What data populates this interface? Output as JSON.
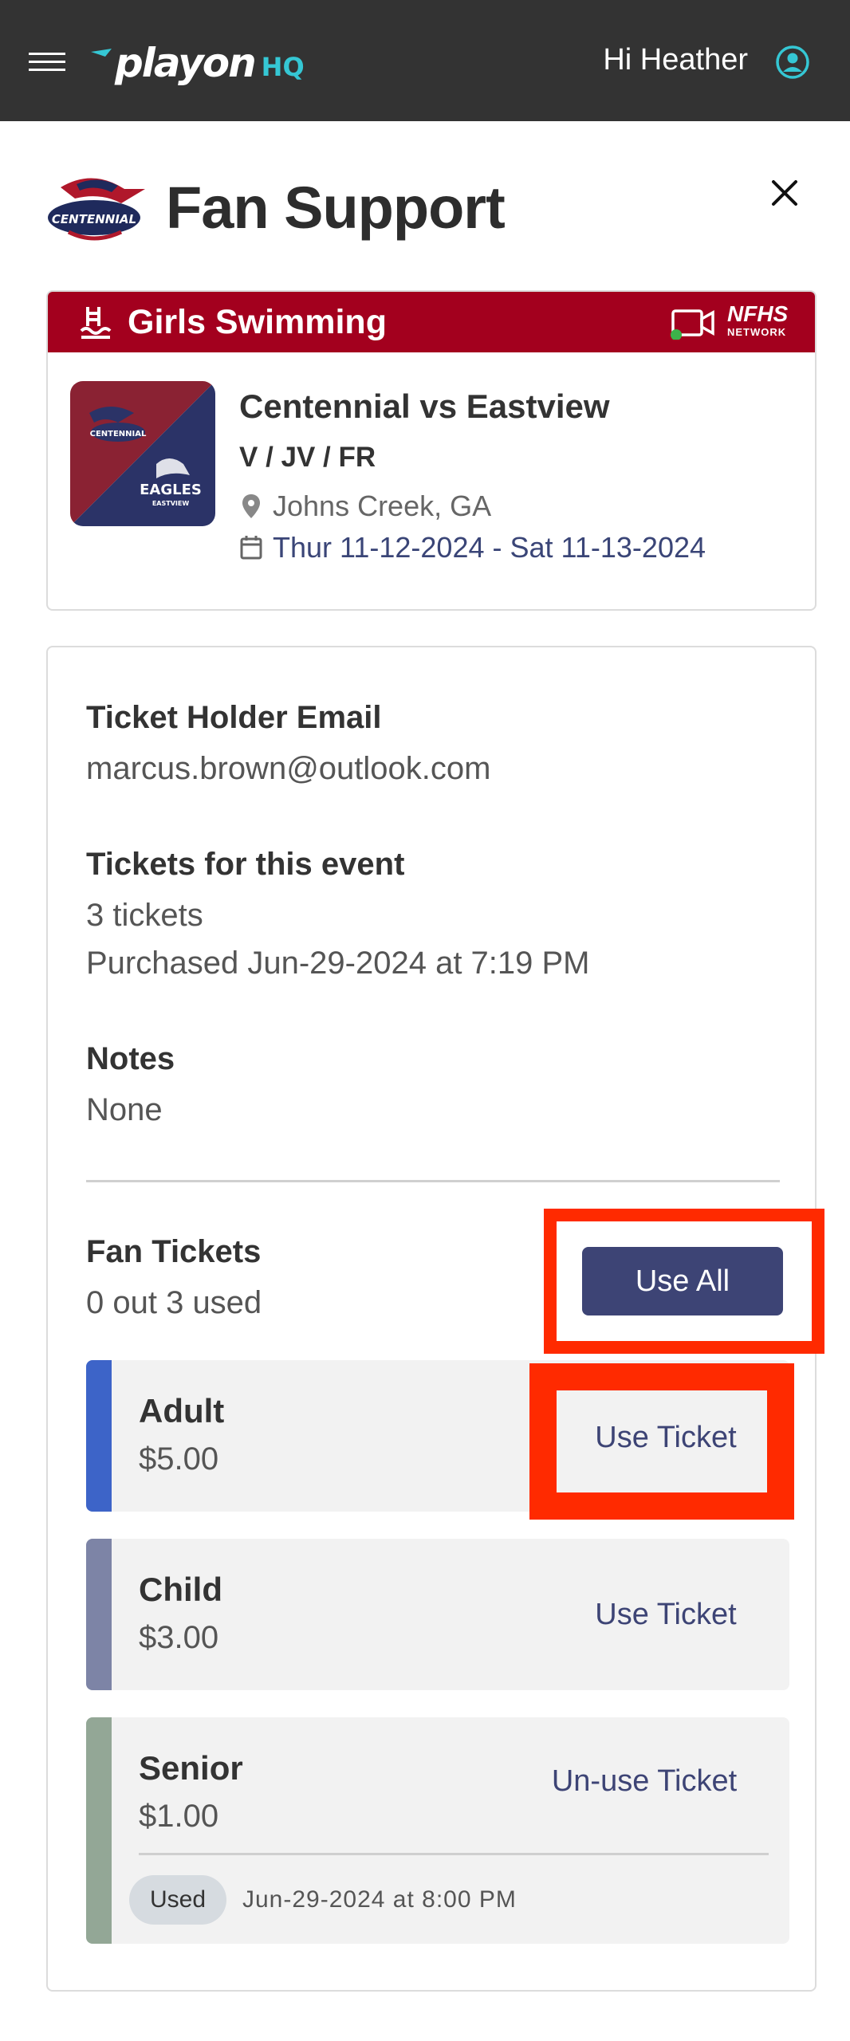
{
  "nav": {
    "brand": "playon",
    "brand_suffix": "HQ",
    "greeting": "Hi Heather"
  },
  "header": {
    "school_logo_text": "CENTENNIAL",
    "title": "Fan Support"
  },
  "event": {
    "sport": "Girls Swimming",
    "network": "NFHS",
    "network_sub": "NETWORK",
    "name": "Centennial vs Eastview",
    "levels": "V / JV / FR",
    "location": "Johns Creek, GA",
    "dates": "Thur 11-12-2024 - Sat 11-13-2024",
    "home_team_label": "CENTENNIAL",
    "away_team_label": "EAGLES",
    "away_team_sub": "EASTVIEW",
    "colors": {
      "sport_bar": "#a3001e",
      "home": "#8a2233",
      "away": "#2b3367"
    }
  },
  "details": {
    "email_label": "Ticket Holder Email",
    "email_value": "marcus.brown@outlook.com",
    "tickets_label": "Tickets for this event",
    "tickets_count": "3 tickets",
    "purchased": "Purchased Jun-29-2024 at 7:19 PM",
    "notes_label": "Notes",
    "notes_value": "None"
  },
  "fan_tickets": {
    "label": "Fan Tickets",
    "used_summary": "0 out 3 used",
    "use_all_label": "Use All",
    "items": [
      {
        "type": "Adult",
        "price": "$5.00",
        "action": "Use Ticket",
        "stripe": "#3d64c8"
      },
      {
        "type": "Child",
        "price": "$3.00",
        "action": "Use Ticket",
        "stripe": "#7d84a6"
      },
      {
        "type": "Senior",
        "price": "$1.00",
        "action": "Un-use Ticket",
        "stripe": "#93a796",
        "status": "Used",
        "used_at": "Jun-29-2024 at 8:00 PM"
      }
    ]
  },
  "colors": {
    "highlight": "#ff2a00",
    "primary": "#3d4475",
    "topbar": "#333333"
  }
}
